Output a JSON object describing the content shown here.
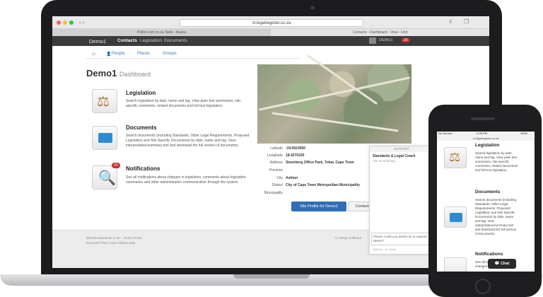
{
  "browser": {
    "url": "ct.legalregister.co.za",
    "tabs": [
      "Pollie's ton co.za Tadie - Asana",
      "Contacts - Dashboard - View - Unit"
    ]
  },
  "nav": {
    "brand": "Demo1",
    "items": [
      "Contacts",
      "Legislation",
      "Documents"
    ],
    "user": "DEMO1",
    "badge": "20"
  },
  "subnav": {
    "items": [
      "People",
      "Places",
      "Groups"
    ]
  },
  "page": {
    "title": "Demo1",
    "subtitle": "Dashboard"
  },
  "sections": [
    {
      "title": "Legislation",
      "text": "Search legislation by date, name and tag. View plain text summaries, site-specific comments, related documents and full-text legislation."
    },
    {
      "title": "Documents",
      "text": "Search documents (including Standards, Other Legal Requirements, Proposed Legislation and Site Specific Documents) by date, name and tag. View interpretation/summary text and download the full version of documents."
    },
    {
      "title": "Notifications",
      "badge": "20",
      "text": "See all notifications about changes in legislation, comments about legislation summaries and other administrative communication through the system."
    }
  ],
  "site_info": {
    "latitude_label": "Latitude",
    "latitude": "-34.0023050",
    "longitude_label": "Longitude",
    "longitude": "18.4270220",
    "address_label": "Address",
    "address": "Steenberg Office Park, Tokai, Cape Town",
    "province_label": "Province",
    "province": "",
    "city_label": "City",
    "city": "Ashton",
    "district_label": "District",
    "district": "City of Cape Town Metropolitan Municipality",
    "municipality_label": "Municipality",
    "municipality": ""
  },
  "buttons": {
    "site_profile": "Site Profile for Demo1",
    "contact": "Contact"
  },
  "chat": {
    "header": "SUPPORT",
    "agent": "Standards & Legal Coach",
    "status": "Ask us anything",
    "input_placeholder": "Please could you assist me in regards NEMA?",
    "footer_links": "Options · Hi, Heidi"
  },
  "footer": {
    "line1": "@2015 Enterprise 1 Lex · Terms of Use",
    "line2": "Executed Time: 0.012 milliseconds",
    "right": "© Unisys Software"
  },
  "phone": {
    "status_left": "No Service",
    "time": "2:28 PM",
    "battery": "100%",
    "url": "ct.legalregister.co.za",
    "sections": [
      {
        "title": "Legislation",
        "text": "Search legislation by date, name and tag. View plain text summaries, site-specific comments, related documents and full-text legislation."
      },
      {
        "title": "Documents",
        "text": "Search documents (including Standards, Other Legal Requirements, Proposed Legislation and Site Specific Documents) by date, name and tag. View interpretation/summary text and download the full version of documents."
      },
      {
        "title": "Notifications",
        "text": "See all notifications about changes in legislation"
      }
    ],
    "chat_label": "Chat"
  }
}
